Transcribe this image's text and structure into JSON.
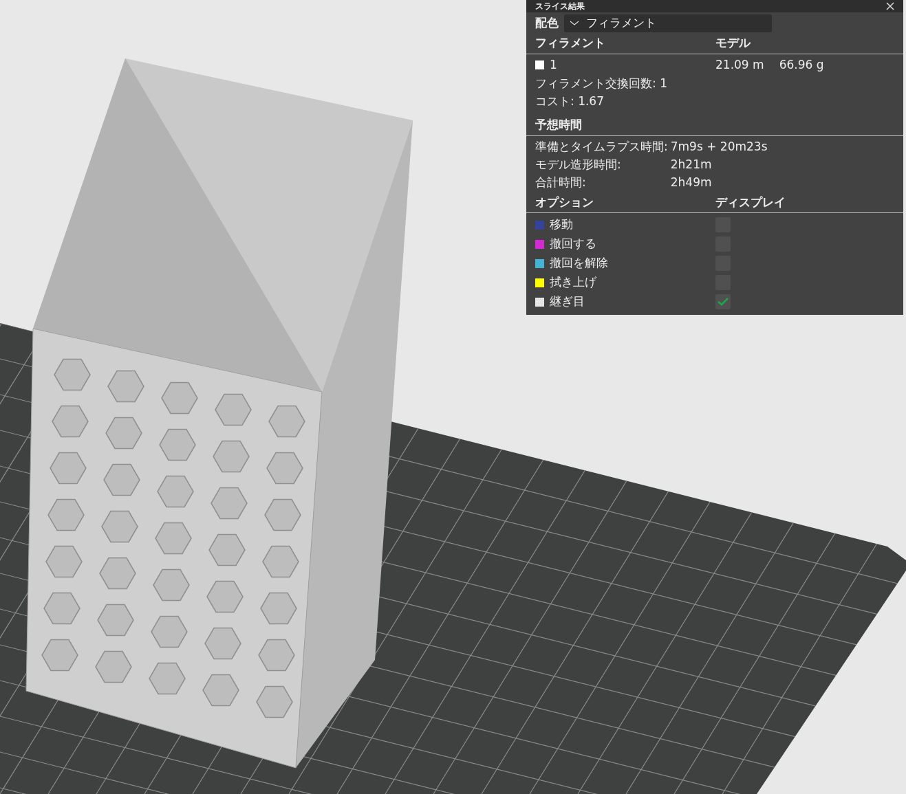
{
  "panel": {
    "title": "スライス結果",
    "color_scheme": {
      "label": "配色",
      "value": "フィラメント"
    },
    "filament_header": [
      "フィラメント",
      "モデル"
    ],
    "filaments": [
      {
        "name": "1",
        "color": "#ffffff",
        "length": "21.09 m",
        "weight": "66.96 g"
      }
    ],
    "stats": [
      "フィラメント交換回数: 1",
      "コスト: 1.67"
    ],
    "time_header": "予想時間",
    "times": [
      {
        "label": "準備とタイムラプス時間:",
        "value": "7m9s + 20m23s"
      },
      {
        "label": "モデル造形時間:",
        "value": "2h21m"
      },
      {
        "label": "合計時間:",
        "value": "2h49m"
      }
    ],
    "options_header": [
      "オプション",
      "ディスプレイ"
    ],
    "options": [
      {
        "label": "移動",
        "color": "#34449a",
        "checked": false
      },
      {
        "label": "撤回する",
        "color": "#d42ad4",
        "checked": false
      },
      {
        "label": "撤回を解除",
        "color": "#45b4d4",
        "checked": false
      },
      {
        "label": "拭き上げ",
        "color": "#ffff00",
        "checked": false
      },
      {
        "label": "継ぎ目",
        "color": "#e6e6e6",
        "checked": true
      }
    ]
  }
}
